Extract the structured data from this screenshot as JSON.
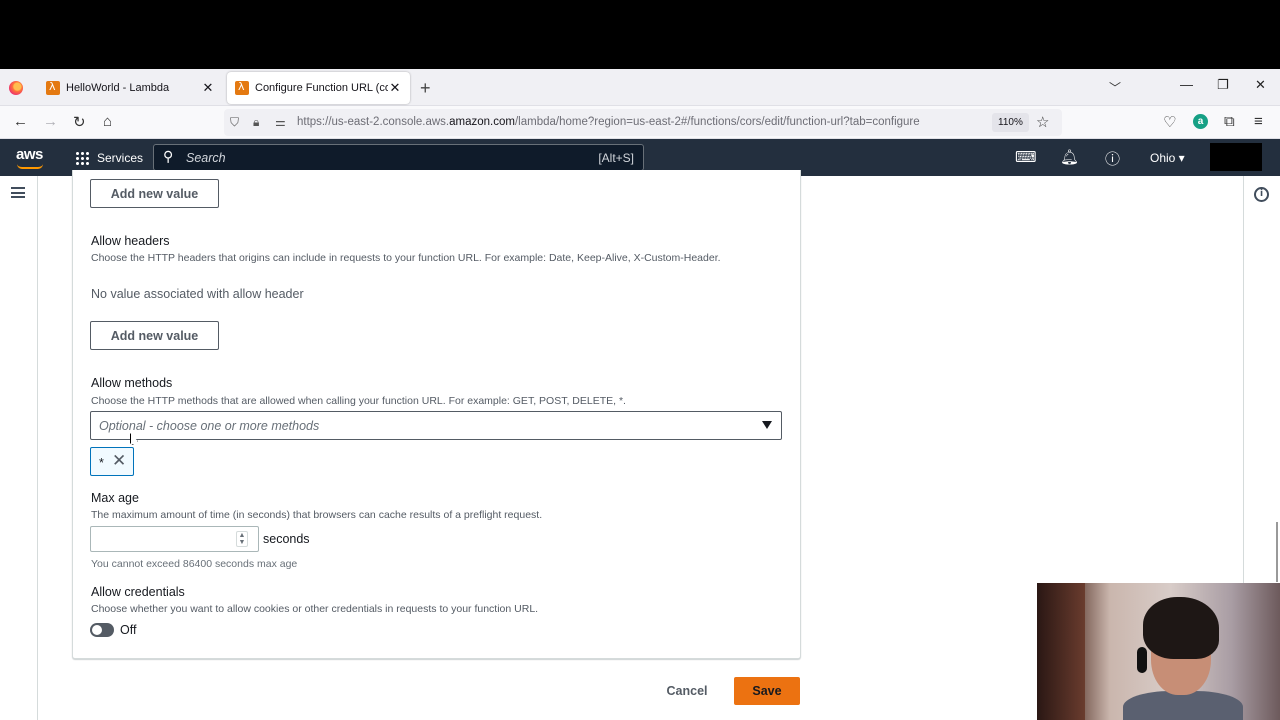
{
  "browser": {
    "tabs": [
      {
        "title": "HelloWorld - Lambda",
        "active": false
      },
      {
        "title": "Configure Function URL (cors) - ",
        "active": true
      }
    ],
    "url_rest_prefix": "https://us-east-2.console.aws.",
    "url_host": "amazon.com",
    "url_path": "/lambda/home?region=us-east-2#/functions/cors/edit/function-url?tab=configure",
    "zoom": "110%"
  },
  "aws_nav": {
    "services": "Services",
    "search_placeholder": "Search",
    "search_shortcut": "[Alt+S]",
    "region": "Ohio ▾"
  },
  "form": {
    "add_value_label": "Add new value",
    "allow_headers": {
      "title": "Allow headers",
      "description": "Choose the HTTP headers that origins can include in requests to your function URL. For example: Date, Keep-Alive, X-Custom-Header.",
      "empty": "No value associated with allow header"
    },
    "allow_methods": {
      "title": "Allow methods",
      "description": "Choose the HTTP methods that are allowed when calling your function URL. For example: GET, POST, DELETE, *.",
      "placeholder": "Optional - choose one or more methods",
      "selected": [
        "*"
      ]
    },
    "max_age": {
      "title": "Max age",
      "description": "The maximum amount of time (in seconds) that browsers can cache results of a preflight request.",
      "value": "",
      "unit": "seconds",
      "hint": "You cannot exceed 86400 seconds max age"
    },
    "allow_credentials": {
      "title": "Allow credentials",
      "description": "Choose whether you want to allow cookies or other credentials in requests to your function URL.",
      "state": "Off"
    },
    "cancel": "Cancel",
    "save": "Save"
  },
  "colors": {
    "aws_nav_bg": "#232f3e",
    "primary_orange": "#ec7211",
    "token_border": "#0073bb"
  }
}
